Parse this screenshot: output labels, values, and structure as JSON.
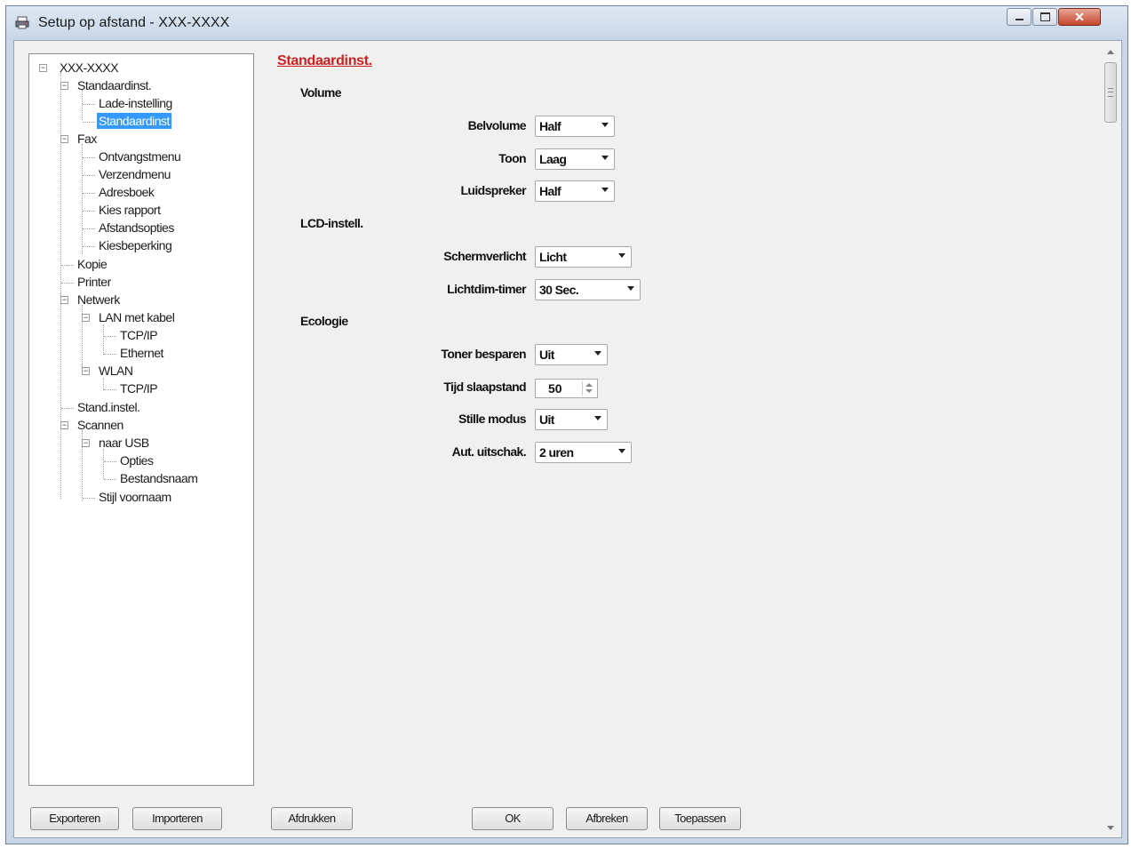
{
  "window": {
    "title": "Setup op afstand - XXX-XXXX",
    "icon": "printer-setup-icon",
    "controls": {
      "minimize": "minimize-icon",
      "maximize": "maximize-icon",
      "close": "close-icon"
    }
  },
  "tree": {
    "root": "XXX-XXXX",
    "items": [
      "Standaardinst.",
      "Lade-instelling",
      "Standaardinst",
      "Fax",
      "Ontvangstmenu",
      "Verzendmenu",
      "Adresboek",
      "Kies rapport",
      "Afstandsopties",
      "Kiesbeperking",
      "Kopie",
      "Printer",
      "Netwerk",
      "LAN met kabel",
      "TCP/IP",
      "Ethernet",
      "WLAN",
      "TCP/IP",
      "Stand.instel.",
      "Scannen",
      "naar USB",
      "Opties",
      "Bestandsnaam",
      "Stijl voornaam"
    ],
    "selected": "Standaardinst"
  },
  "panel": {
    "heading": "Standaardinst.",
    "sections": {
      "volume": {
        "title": "Volume",
        "belvolume": {
          "label": "Belvolume",
          "value": "Half"
        },
        "toon": {
          "label": "Toon",
          "value": "Laag"
        },
        "luidspreker": {
          "label": "Luidspreker",
          "value": "Half"
        }
      },
      "lcd": {
        "title": "LCD-instell.",
        "schermverlicht": {
          "label": "Schermverlicht",
          "value": "Licht"
        },
        "lichtdim": {
          "label": "Lichtdim-timer",
          "value": "30 Sec."
        }
      },
      "ecologie": {
        "title": "Ecologie",
        "toner": {
          "label": "Toner besparen",
          "value": "Uit"
        },
        "slaap": {
          "label": "Tijd slaapstand",
          "value": "50"
        },
        "stille": {
          "label": "Stille modus",
          "value": "Uit"
        },
        "uitschak": {
          "label": "Aut. uitschak.",
          "value": "2 uren"
        }
      }
    }
  },
  "buttons": {
    "exporteren": "Exporteren",
    "importeren": "Importeren",
    "afdrukken": "Afdrukken",
    "ok": "OK",
    "afbreken": "Afbreken",
    "toepassen": "Toepassen"
  },
  "colors": {
    "heading": "#cc2020",
    "selection": "#3399ff",
    "client": "#f0f0f0"
  }
}
